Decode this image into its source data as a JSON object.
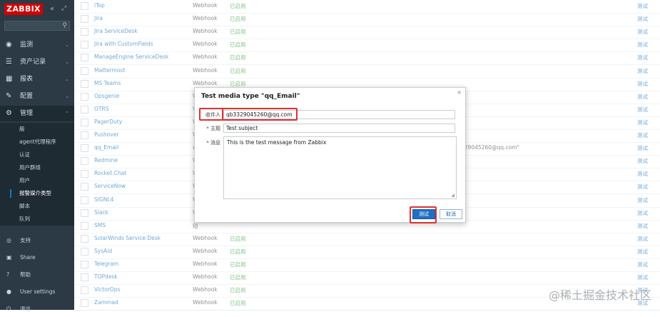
{
  "sidebar": {
    "logo": "ZABBIX",
    "collapse_icon": "«",
    "kiosk_icon": "⤢",
    "search_placeholder": "",
    "nav": [
      {
        "label": "监测",
        "icon": "eye-icon"
      },
      {
        "label": "资产记录",
        "icon": "list-icon"
      },
      {
        "label": "报表",
        "icon": "chart-icon"
      },
      {
        "label": "配置",
        "icon": "wrench-icon"
      },
      {
        "label": "管理",
        "icon": "gear-icon"
      }
    ],
    "sub": [
      "般",
      "agent代理程序",
      "认证",
      "用户群组",
      "用户",
      "报警媒介类型",
      "脚本",
      "队列"
    ],
    "bottom": [
      {
        "label": "支持",
        "icon": "support-icon"
      },
      {
        "label": "Share",
        "icon": "share-icon"
      },
      {
        "label": "帮助",
        "icon": "help-icon"
      },
      {
        "label": "User settings",
        "icon": "user-icon"
      },
      {
        "label": "退出",
        "icon": "logout-icon"
      }
    ]
  },
  "table": {
    "rows": [
      {
        "name": "iTop",
        "type": "Webhook",
        "status": "已启用",
        "test": "测试"
      },
      {
        "name": "Jira",
        "type": "Webhook",
        "status": "已启用",
        "test": "测试"
      },
      {
        "name": "Jira ServiceDesk",
        "type": "Webhook",
        "status": "已启用",
        "test": "测试"
      },
      {
        "name": "Jira with CustomFields",
        "type": "Webhook",
        "status": "已启用",
        "test": "测试"
      },
      {
        "name": "ManageEngine ServiceDesk",
        "type": "Webhook",
        "status": "已启用",
        "test": "测试"
      },
      {
        "name": "Mattermost",
        "type": "Webhook",
        "status": "已启用",
        "test": "测试"
      },
      {
        "name": "MS Teams",
        "type": "Webhook",
        "status": "已启用",
        "test": "测试"
      },
      {
        "name": "Opsgenie",
        "type": "Webhook",
        "status": "",
        "test": "测试"
      },
      {
        "name": "OTRS",
        "type": "W",
        "status": "",
        "test": "测试"
      },
      {
        "name": "PagerDuty",
        "type": "W",
        "status": "",
        "test": "测试"
      },
      {
        "name": "Pushover",
        "type": "W",
        "status": "",
        "test": "测试"
      },
      {
        "name": "qq_Email",
        "type": "申",
        "status": "",
        "test": "测试",
        "extra": "329045260@qq.com\""
      },
      {
        "name": "Redmine",
        "type": "W",
        "status": "",
        "test": "测试"
      },
      {
        "name": "Rocket.Chat",
        "type": "W",
        "status": "",
        "test": "测试"
      },
      {
        "name": "ServiceNow",
        "type": "W",
        "status": "",
        "test": "测试"
      },
      {
        "name": "SIGNL4",
        "type": "W",
        "status": "",
        "test": "测试"
      },
      {
        "name": "Slack",
        "type": "W",
        "status": "",
        "test": "测试"
      },
      {
        "name": "SMS",
        "type": "短",
        "status": "",
        "test": "测试"
      },
      {
        "name": "SolarWinds Service Desk",
        "type": "Webhook",
        "status": "已启用",
        "test": "测试"
      },
      {
        "name": "SysAid",
        "type": "Webhook",
        "status": "已启用",
        "test": "测试"
      },
      {
        "name": "Telegram",
        "type": "Webhook",
        "status": "已启用",
        "test": "测试"
      },
      {
        "name": "TOPdesk",
        "type": "Webhook",
        "status": "已启用",
        "test": "测试"
      },
      {
        "name": "VictorOps",
        "type": "Webhook",
        "status": "已启用",
        "test": "测试"
      },
      {
        "name": "Zammad",
        "type": "Webhook",
        "status": "已启用",
        "test": "测试"
      }
    ]
  },
  "dialog": {
    "title": "Test media type \"qq_Email\"",
    "close": "×",
    "to_label": "收件人",
    "to_value": "qb3329045260@qq.com",
    "subject_label": "* 主题",
    "subject_value": "Test subject",
    "message_label": "* 消息",
    "message_value": "This is the test message from Zabbix",
    "test_button": "测试",
    "cancel_button": "取消",
    "highlight_color": "#e23030"
  },
  "watermark": "@稀土掘金技术社区"
}
